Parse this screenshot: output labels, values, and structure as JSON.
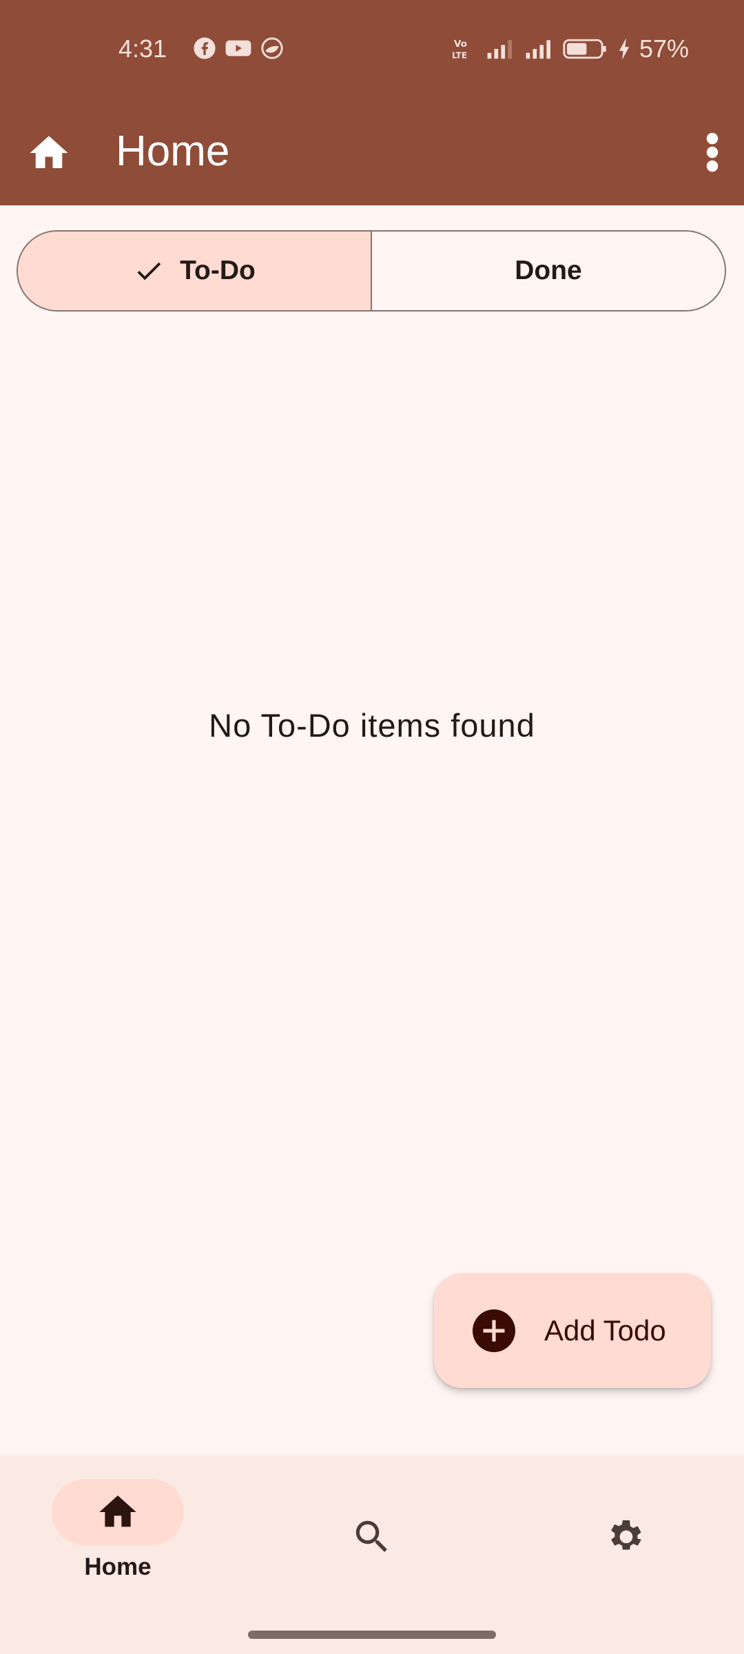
{
  "status_bar": {
    "time": "4:31",
    "battery": "57%",
    "app_icons": [
      "facebook-icon",
      "youtube-icon",
      "vpn-icon"
    ]
  },
  "app_bar": {
    "title": "Home",
    "leading_icon": "home-icon",
    "trailing_icon": "more-vert-icon"
  },
  "tabs": {
    "todo_label": "To-Do",
    "done_label": "Done",
    "selected": "To-Do"
  },
  "empty_state": {
    "message": "No To-Do items found"
  },
  "fab": {
    "label": "Add Todo",
    "icon": "add-circle-icon"
  },
  "bottom_nav": {
    "items": [
      {
        "label": "Home",
        "icon": "home-icon",
        "active": true
      },
      {
        "label": "",
        "icon": "search-icon",
        "active": false
      },
      {
        "label": "",
        "icon": "settings-icon",
        "active": false
      }
    ]
  },
  "colors": {
    "primary": "#8F4C38",
    "surface": "#FFF5F3",
    "container": "#FFDBD1",
    "nav_background": "#FBE9E4"
  }
}
